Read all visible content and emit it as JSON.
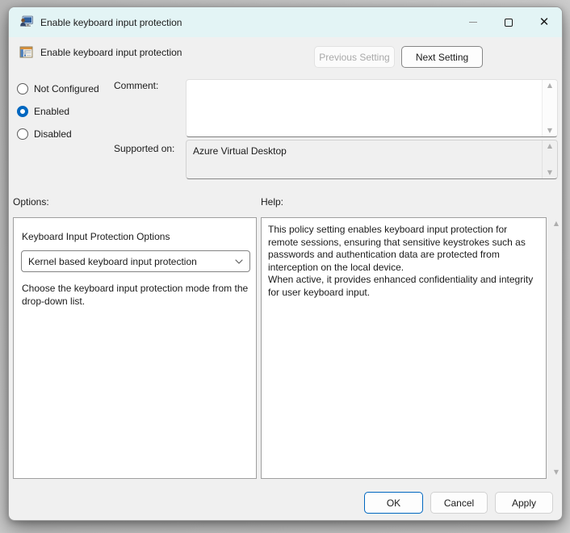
{
  "window": {
    "title": "Enable keyboard input protection",
    "controls": {
      "minimize": "minimize",
      "maximize": "maximize",
      "close": "✕"
    }
  },
  "header": {
    "setting_name": "Enable keyboard input protection",
    "previous_button": "Previous Setting",
    "next_button": "Next Setting"
  },
  "state": {
    "radios": [
      {
        "label": "Not Configured",
        "selected": false
      },
      {
        "label": "Enabled",
        "selected": true
      },
      {
        "label": "Disabled",
        "selected": false
      }
    ],
    "comment_label": "Comment:",
    "comment_value": "",
    "supported_label": "Supported on:",
    "supported_value": "Azure Virtual Desktop"
  },
  "options": {
    "section_label": "Options:",
    "dropdown_label": "Keyboard Input Protection Options",
    "dropdown_value": "Kernel based keyboard input protection",
    "description": "Choose the keyboard input protection mode from the drop-down list."
  },
  "help": {
    "section_label": "Help:",
    "text": "This policy setting enables keyboard input protection for remote sessions, ensuring that sensitive keystrokes such as passwords and authentication data are protected from interception on the local device.\nWhen active, it provides enhanced confidentiality and integrity for user keyboard input."
  },
  "footer": {
    "ok": "OK",
    "cancel": "Cancel",
    "apply": "Apply"
  },
  "colors": {
    "titlebar_bg": "#e3f4f5",
    "dialog_bg": "#f0f0f0",
    "accent_blue": "#0067c0",
    "disabled_text": "#a9a9a9"
  }
}
